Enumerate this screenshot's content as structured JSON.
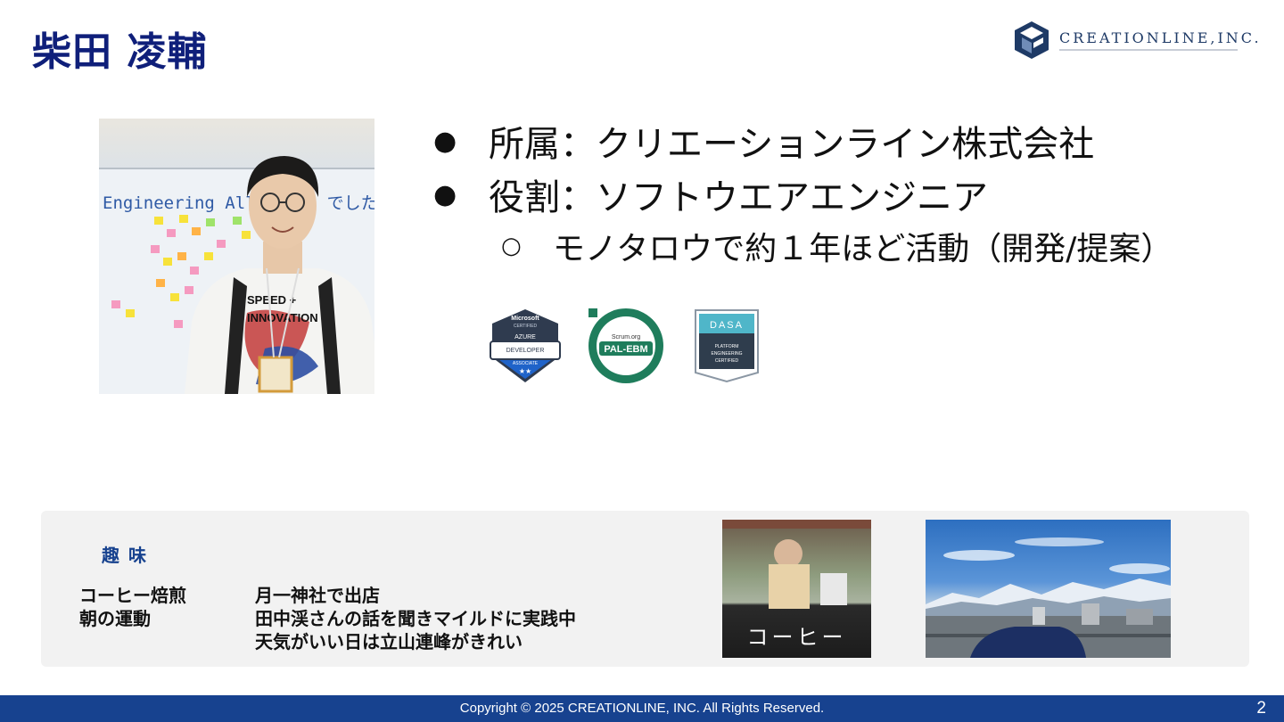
{
  "slide": {
    "title": "柴田 凌輔",
    "logo_text": "CREATIONLINE,INC."
  },
  "profile": {
    "bullets": [
      {
        "text": "所属：クリエーションライン株式会社"
      },
      {
        "text": "役割：ソフトウエアエンジニア"
      }
    ],
    "sub_bullet": "モノタロウで約１年ほど活動（開発/提案）",
    "bullet_symbol": "●",
    "sub_bullet_symbol": "○"
  },
  "photo": {
    "board_text": "Engineering All Hands でした？",
    "tshirt_text_1": "SPEED +",
    "tshirt_text_2": "INNOVATION"
  },
  "badges": {
    "microsoft": {
      "brand": "Microsoft",
      "sub": "CERTIFIED",
      "line1": "AZURE",
      "line2": "DEVELOPER",
      "level": "ASSOCIATE",
      "stars": "★★"
    },
    "scrum": {
      "site": "Scrum.org",
      "name": "PAL-EBM"
    },
    "dasa": {
      "brand": "DASA",
      "line1": "PLATFORM",
      "line2": "ENGINEERING",
      "line3": "CERTIFIED"
    }
  },
  "hobby": {
    "title": "趣味",
    "rows": [
      {
        "label": "コーヒー焙煎",
        "value": "月一神社で出店"
      },
      {
        "label": "朝の運動",
        "value": "田中渓さんの話を聞きマイルドに実践中"
      },
      {
        "label": "",
        "value": "天気がいい日は立山連峰がきれい"
      }
    ],
    "coffee_sign": "コーヒー"
  },
  "footer": {
    "copyright": "Copyright © 2025 CREATIONLINE, INC. All Rights Reserved.",
    "page_number": "2"
  },
  "colors": {
    "title": "#0f1f7a",
    "footer": "#17428f",
    "hobby_bg": "#f2f2f2"
  }
}
